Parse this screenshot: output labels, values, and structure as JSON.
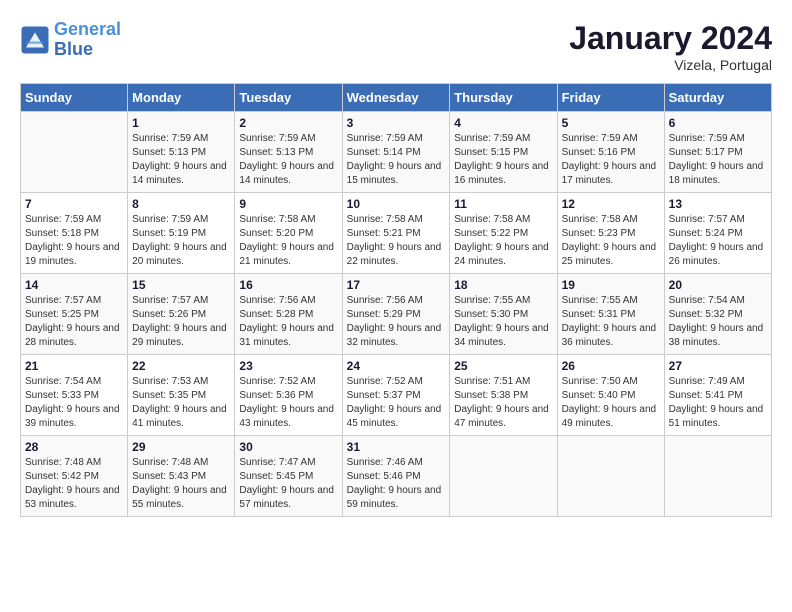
{
  "header": {
    "logo_line1": "General",
    "logo_line2": "Blue",
    "month": "January 2024",
    "location": "Vizela, Portugal"
  },
  "days_of_week": [
    "Sunday",
    "Monday",
    "Tuesday",
    "Wednesday",
    "Thursday",
    "Friday",
    "Saturday"
  ],
  "weeks": [
    [
      {
        "num": "",
        "info": ""
      },
      {
        "num": "1",
        "info": "Sunrise: 7:59 AM\nSunset: 5:13 PM\nDaylight: 9 hours\nand 14 minutes."
      },
      {
        "num": "2",
        "info": "Sunrise: 7:59 AM\nSunset: 5:13 PM\nDaylight: 9 hours\nand 14 minutes."
      },
      {
        "num": "3",
        "info": "Sunrise: 7:59 AM\nSunset: 5:14 PM\nDaylight: 9 hours\nand 15 minutes."
      },
      {
        "num": "4",
        "info": "Sunrise: 7:59 AM\nSunset: 5:15 PM\nDaylight: 9 hours\nand 16 minutes."
      },
      {
        "num": "5",
        "info": "Sunrise: 7:59 AM\nSunset: 5:16 PM\nDaylight: 9 hours\nand 17 minutes."
      },
      {
        "num": "6",
        "info": "Sunrise: 7:59 AM\nSunset: 5:17 PM\nDaylight: 9 hours\nand 18 minutes."
      }
    ],
    [
      {
        "num": "7",
        "info": "Sunrise: 7:59 AM\nSunset: 5:18 PM\nDaylight: 9 hours\nand 19 minutes."
      },
      {
        "num": "8",
        "info": "Sunrise: 7:59 AM\nSunset: 5:19 PM\nDaylight: 9 hours\nand 20 minutes."
      },
      {
        "num": "9",
        "info": "Sunrise: 7:58 AM\nSunset: 5:20 PM\nDaylight: 9 hours\nand 21 minutes."
      },
      {
        "num": "10",
        "info": "Sunrise: 7:58 AM\nSunset: 5:21 PM\nDaylight: 9 hours\nand 22 minutes."
      },
      {
        "num": "11",
        "info": "Sunrise: 7:58 AM\nSunset: 5:22 PM\nDaylight: 9 hours\nand 24 minutes."
      },
      {
        "num": "12",
        "info": "Sunrise: 7:58 AM\nSunset: 5:23 PM\nDaylight: 9 hours\nand 25 minutes."
      },
      {
        "num": "13",
        "info": "Sunrise: 7:57 AM\nSunset: 5:24 PM\nDaylight: 9 hours\nand 26 minutes."
      }
    ],
    [
      {
        "num": "14",
        "info": "Sunrise: 7:57 AM\nSunset: 5:25 PM\nDaylight: 9 hours\nand 28 minutes."
      },
      {
        "num": "15",
        "info": "Sunrise: 7:57 AM\nSunset: 5:26 PM\nDaylight: 9 hours\nand 29 minutes."
      },
      {
        "num": "16",
        "info": "Sunrise: 7:56 AM\nSunset: 5:28 PM\nDaylight: 9 hours\nand 31 minutes."
      },
      {
        "num": "17",
        "info": "Sunrise: 7:56 AM\nSunset: 5:29 PM\nDaylight: 9 hours\nand 32 minutes."
      },
      {
        "num": "18",
        "info": "Sunrise: 7:55 AM\nSunset: 5:30 PM\nDaylight: 9 hours\nand 34 minutes."
      },
      {
        "num": "19",
        "info": "Sunrise: 7:55 AM\nSunset: 5:31 PM\nDaylight: 9 hours\nand 36 minutes."
      },
      {
        "num": "20",
        "info": "Sunrise: 7:54 AM\nSunset: 5:32 PM\nDaylight: 9 hours\nand 38 minutes."
      }
    ],
    [
      {
        "num": "21",
        "info": "Sunrise: 7:54 AM\nSunset: 5:33 PM\nDaylight: 9 hours\nand 39 minutes."
      },
      {
        "num": "22",
        "info": "Sunrise: 7:53 AM\nSunset: 5:35 PM\nDaylight: 9 hours\nand 41 minutes."
      },
      {
        "num": "23",
        "info": "Sunrise: 7:52 AM\nSunset: 5:36 PM\nDaylight: 9 hours\nand 43 minutes."
      },
      {
        "num": "24",
        "info": "Sunrise: 7:52 AM\nSunset: 5:37 PM\nDaylight: 9 hours\nand 45 minutes."
      },
      {
        "num": "25",
        "info": "Sunrise: 7:51 AM\nSunset: 5:38 PM\nDaylight: 9 hours\nand 47 minutes."
      },
      {
        "num": "26",
        "info": "Sunrise: 7:50 AM\nSunset: 5:40 PM\nDaylight: 9 hours\nand 49 minutes."
      },
      {
        "num": "27",
        "info": "Sunrise: 7:49 AM\nSunset: 5:41 PM\nDaylight: 9 hours\nand 51 minutes."
      }
    ],
    [
      {
        "num": "28",
        "info": "Sunrise: 7:48 AM\nSunset: 5:42 PM\nDaylight: 9 hours\nand 53 minutes."
      },
      {
        "num": "29",
        "info": "Sunrise: 7:48 AM\nSunset: 5:43 PM\nDaylight: 9 hours\nand 55 minutes."
      },
      {
        "num": "30",
        "info": "Sunrise: 7:47 AM\nSunset: 5:45 PM\nDaylight: 9 hours\nand 57 minutes."
      },
      {
        "num": "31",
        "info": "Sunrise: 7:46 AM\nSunset: 5:46 PM\nDaylight: 9 hours\nand 59 minutes."
      },
      {
        "num": "",
        "info": ""
      },
      {
        "num": "",
        "info": ""
      },
      {
        "num": "",
        "info": ""
      }
    ]
  ]
}
